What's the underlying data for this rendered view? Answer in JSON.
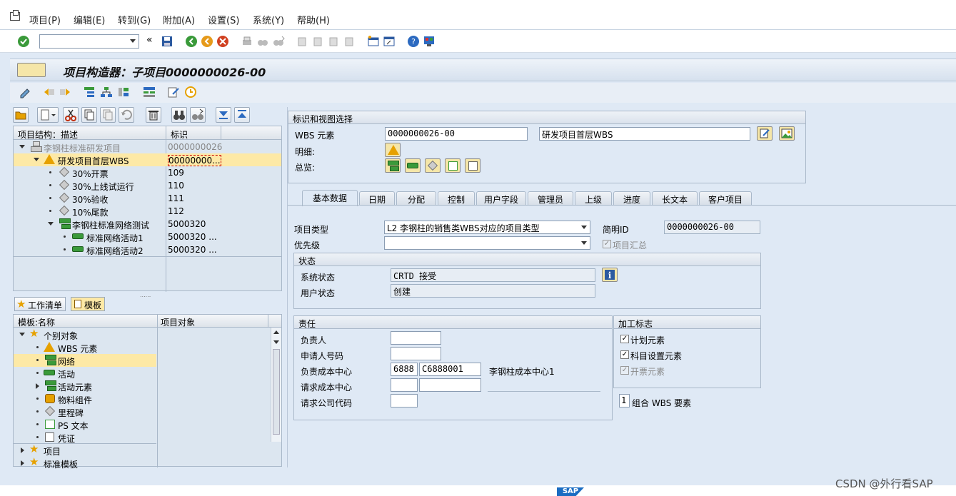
{
  "menu": {
    "items": [
      "项目(P)",
      "编辑(E)",
      "转到(G)",
      "附加(A)",
      "设置(S)",
      "系统(Y)",
      "帮助(H)"
    ]
  },
  "toolbar": {
    "command_field_value": "",
    "icons": [
      "enter-icon",
      "back-icon",
      "exit-icon",
      "cancel-icon",
      "print-icon",
      "find-icon",
      "find-next-icon",
      "first-page-icon",
      "prev-page-icon",
      "next-page-icon",
      "last-page-icon",
      "new-session-icon",
      "shortcut-icon",
      "help-icon",
      "layout-icon"
    ]
  },
  "title": "项目构造器：子项目0000000026-00",
  "structure_tree": {
    "col_desc": "项目结构：描述",
    "col_id": "标识",
    "rows": [
      {
        "label": "李钢柱标准研发项目",
        "id": "0000000026",
        "icon": "project-icon",
        "level": 0,
        "expander": "expanded",
        "muted": true
      },
      {
        "label": "研发项目首层WBS",
        "id": "00000000...",
        "icon": "wbs-warning-icon",
        "level": 1,
        "expander": "expanded",
        "selected": true
      },
      {
        "label": "30%开票",
        "id": "109",
        "icon": "milestone-icon",
        "level": 2
      },
      {
        "label": "30%上线试运行",
        "id": "110",
        "icon": "milestone-icon",
        "level": 2
      },
      {
        "label": "30%验收",
        "id": "111",
        "icon": "milestone-icon",
        "level": 2
      },
      {
        "label": "10%尾款",
        "id": "112",
        "icon": "milestone-icon",
        "level": 2
      },
      {
        "label": "李钢柱标准网络测试",
        "id": "5000320",
        "icon": "network-icon",
        "level": 2,
        "expander": "expanded"
      },
      {
        "label": "标准网络活动1",
        "id": "5000320 ...",
        "icon": "activity-icon",
        "level": 3
      },
      {
        "label": "标准网络活动2",
        "id": "5000320 ...",
        "icon": "activity-icon",
        "level": 3
      }
    ]
  },
  "worklist_tabs": {
    "worklist": "工作清单",
    "templates": "模板"
  },
  "template_tree": {
    "col_name": "模板:名称",
    "col_obj": "项目对象",
    "rows": [
      {
        "label": "个别对象",
        "icon": "star-icon",
        "level": 0,
        "expander": "expanded"
      },
      {
        "label": "WBS 元素",
        "icon": "wbs-warning-icon",
        "level": 1
      },
      {
        "label": "网络",
        "icon": "network-icon",
        "level": 1,
        "selected": true
      },
      {
        "label": "活动",
        "icon": "activity-icon",
        "level": 1
      },
      {
        "label": "活动元素",
        "icon": "activity-element-icon",
        "level": 1,
        "expander": "collapsed"
      },
      {
        "label": "物料组件",
        "icon": "material-icon",
        "level": 1
      },
      {
        "label": "里程碑",
        "icon": "milestone-icon",
        "level": 1
      },
      {
        "label": "PS 文本",
        "icon": "ps-text-icon",
        "level": 1
      },
      {
        "label": "凭证",
        "icon": "document-icon",
        "level": 1
      },
      {
        "label": "项目",
        "icon": "star-icon",
        "level": 0,
        "expander": "collapsed"
      },
      {
        "label": "标准模板",
        "icon": "star-icon",
        "level": 0,
        "expander": "collapsed"
      }
    ]
  },
  "identification": {
    "header": "标识和视图选择",
    "wbs_label": "WBS 元素",
    "wbs_value": "0000000026-00",
    "wbs_desc": "研发项目首层WBS",
    "detail_label": "明细:",
    "overview_label": "总览:"
  },
  "tabs": [
    "基本数据",
    "日期",
    "分配",
    "控制",
    "用户字段",
    "管理员",
    "上级",
    "进度",
    "长文本",
    "客户项目"
  ],
  "basic": {
    "project_type_label": "项目类型",
    "project_type_value": "L2 李钢柱的销售类WBS对应的项目类型",
    "short_id_label": "简明ID",
    "short_id_value": "0000000026-00",
    "priority_label": "优先级",
    "priority_value": "",
    "project_summary_label": "项目汇总",
    "project_summary_checked": true
  },
  "status": {
    "header": "状态",
    "system_label": "系统状态",
    "system_value": "CRTD  接受",
    "user_label": "用户状态",
    "user_value": "创建"
  },
  "responsibility": {
    "header": "责任",
    "responsible_label": "负责人",
    "responsible_value": "",
    "applicant_label": "申请人号码",
    "applicant_value": "",
    "resp_cc_label": "负责成本中心",
    "resp_cc_area": "6888",
    "resp_cc_value": "C6888001",
    "resp_cc_desc": "李钢柱成本中心1",
    "req_cc_label": "请求成本中心",
    "req_cc_area": "",
    "req_cc_value": "",
    "req_company_label": "请求公司代码",
    "req_company_value": ""
  },
  "op_flags": {
    "header": "加工标志",
    "planning_label": "计划元素",
    "planning_checked": true,
    "account_label": "科目设置元素",
    "account_checked": true,
    "billing_label": "开票元素",
    "billing_checked": true,
    "grouping_value": "1",
    "grouping_label": "组合 WBS 要素"
  },
  "footer": {
    "logo": "SAP",
    "watermark": "CSDN @外行看SAP"
  }
}
